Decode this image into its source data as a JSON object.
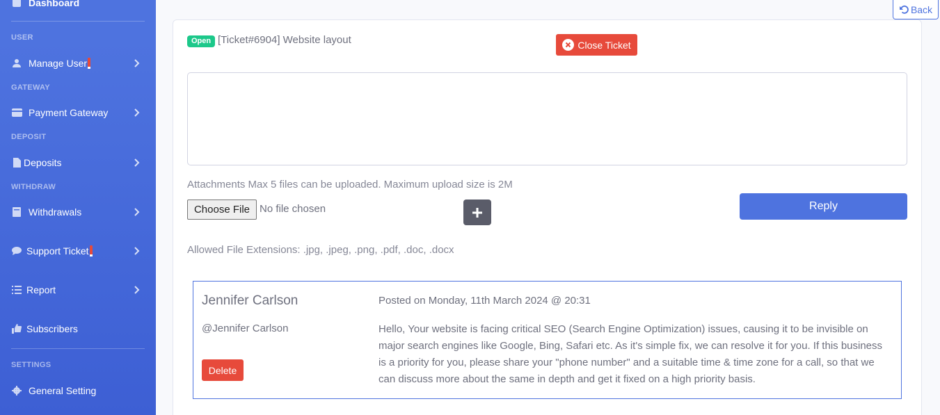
{
  "sidebar": {
    "top_item": "Dashboard",
    "sections": [
      {
        "heading": "USER",
        "items": [
          {
            "label": "Manage User",
            "icon": "user-icon",
            "alert": true
          }
        ]
      },
      {
        "heading": "GATEWAY",
        "items": [
          {
            "label": "Payment Gateway",
            "icon": "credit-card-icon"
          }
        ]
      },
      {
        "heading": "DEPOSIT",
        "items": [
          {
            "label": "Deposits",
            "icon": "file-invoice-icon"
          }
        ]
      },
      {
        "heading": "WITHDRAW",
        "items": [
          {
            "label": "Withdrawals",
            "icon": "book-icon"
          }
        ]
      }
    ],
    "support_ticket": "Support Ticket",
    "report": "Report",
    "subscribers": "Subscribers",
    "settings_heading": "SETTINGS",
    "general_setting": "General Setting"
  },
  "back_label": "Back",
  "ticket": {
    "status": "Open",
    "title": "[Ticket#6904] Website layout",
    "close_label": "Close Ticket"
  },
  "form": {
    "message_value": "",
    "attachments_note": "Attachments Max 5 files can be uploaded. Maximum upload size is 2M",
    "choose_file_label": "Choose File",
    "no_file_text": "No file chosen",
    "reply_label": "Reply",
    "allowed_extensions": "Allowed File Extensions: .jpg, .jpeg, .png, .pdf, .doc, .docx"
  },
  "messages": [
    {
      "name": "Jennifer Carlson",
      "handle": "@Jennifer Carlson",
      "posted": "Posted on Monday, 11th March 2024 @ 20:31",
      "body": "Hello, Your website is facing critical SEO (Search Engine Optimization) issues, causing it to be invisible on major search engines like Google, Bing, Safari etc. As it's simple fix, we can resolve it for you. If this business is a priority for you, please share your \"phone number\" and a suitable time & time zone for a call, so that we can discuss more about the same in depth and get it fixed on a high priority basis.",
      "delete_label": "Delete"
    }
  ],
  "colors": {
    "primary": "#4e73df",
    "danger": "#e74a3b",
    "success": "#1cc88a",
    "dark": "#5a5c69"
  }
}
